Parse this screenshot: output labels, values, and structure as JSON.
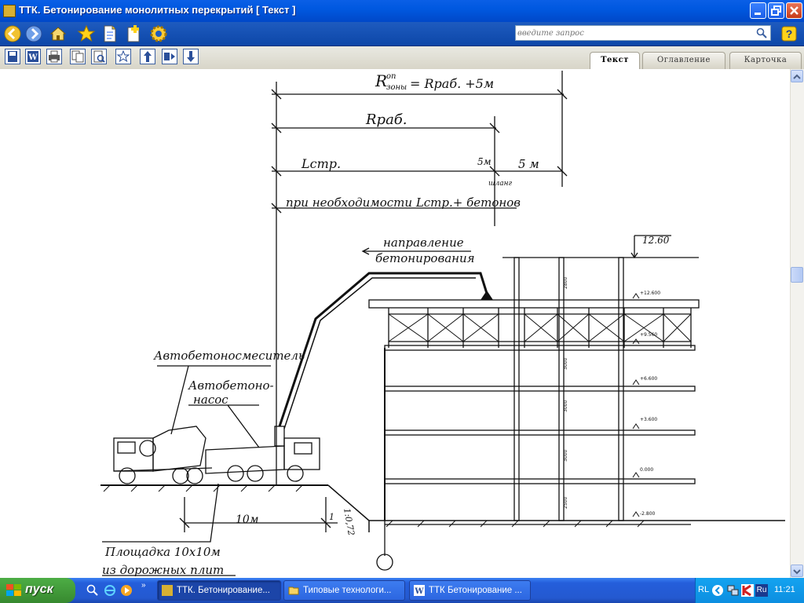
{
  "window": {
    "title": "ТТК. Бетонирование монолитных перекрытий [ Текст ]"
  },
  "search": {
    "placeholder": "введите запрос"
  },
  "tabs": [
    {
      "label": "Текст",
      "active": true
    },
    {
      "label": "Оглавление",
      "active": false
    },
    {
      "label": "Карточка",
      "active": false
    }
  ],
  "drawing": {
    "labels": {
      "r_zone": "R",
      "r_zone_sup": "оп",
      "r_zone_sub": "зоны",
      "r_zone_formula": "= Rраб. +5м",
      "r_work": "Rраб.",
      "l_str": "Lстр.",
      "five_m_a": "5м",
      "five_m_b": "5 м",
      "hose": "шланг",
      "if_needed": "при необходимости Lстр.+ бетонов",
      "direction_1": "направление",
      "direction_2": "бетонирования",
      "height_mark": "12.60",
      "mixer": "Автобетоносмеситель",
      "pump_1": "Автобетоно-",
      "pump_2": "насос",
      "ten_m": "10м",
      "slope": "1:0,72",
      "one": "1",
      "pad_1": "Площадка 10х10м",
      "pad_2": "из дорожных плит"
    },
    "level_marks": [
      "+12.600",
      "+9.560",
      "+6.600",
      "+3.600",
      "0.000",
      "-2.800"
    ],
    "dims": [
      "2800",
      "3000",
      "3000",
      "3000",
      "2500"
    ]
  },
  "taskbar": {
    "start_label": "пуск",
    "tasks": [
      {
        "label": "ТТК. Бетонирование...",
        "active": true
      },
      {
        "label": "Типовые технологи...",
        "active": false
      },
      {
        "label": "ТТК Бетонирование ...",
        "active": false
      }
    ],
    "tray": {
      "language": "RL",
      "input": "Ru",
      "time": "11:21"
    }
  },
  "colors": {
    "titlebar": "#0058e0",
    "toolbar": "#0d47a8",
    "taskbar": "#245edb",
    "start": "#37892f"
  }
}
